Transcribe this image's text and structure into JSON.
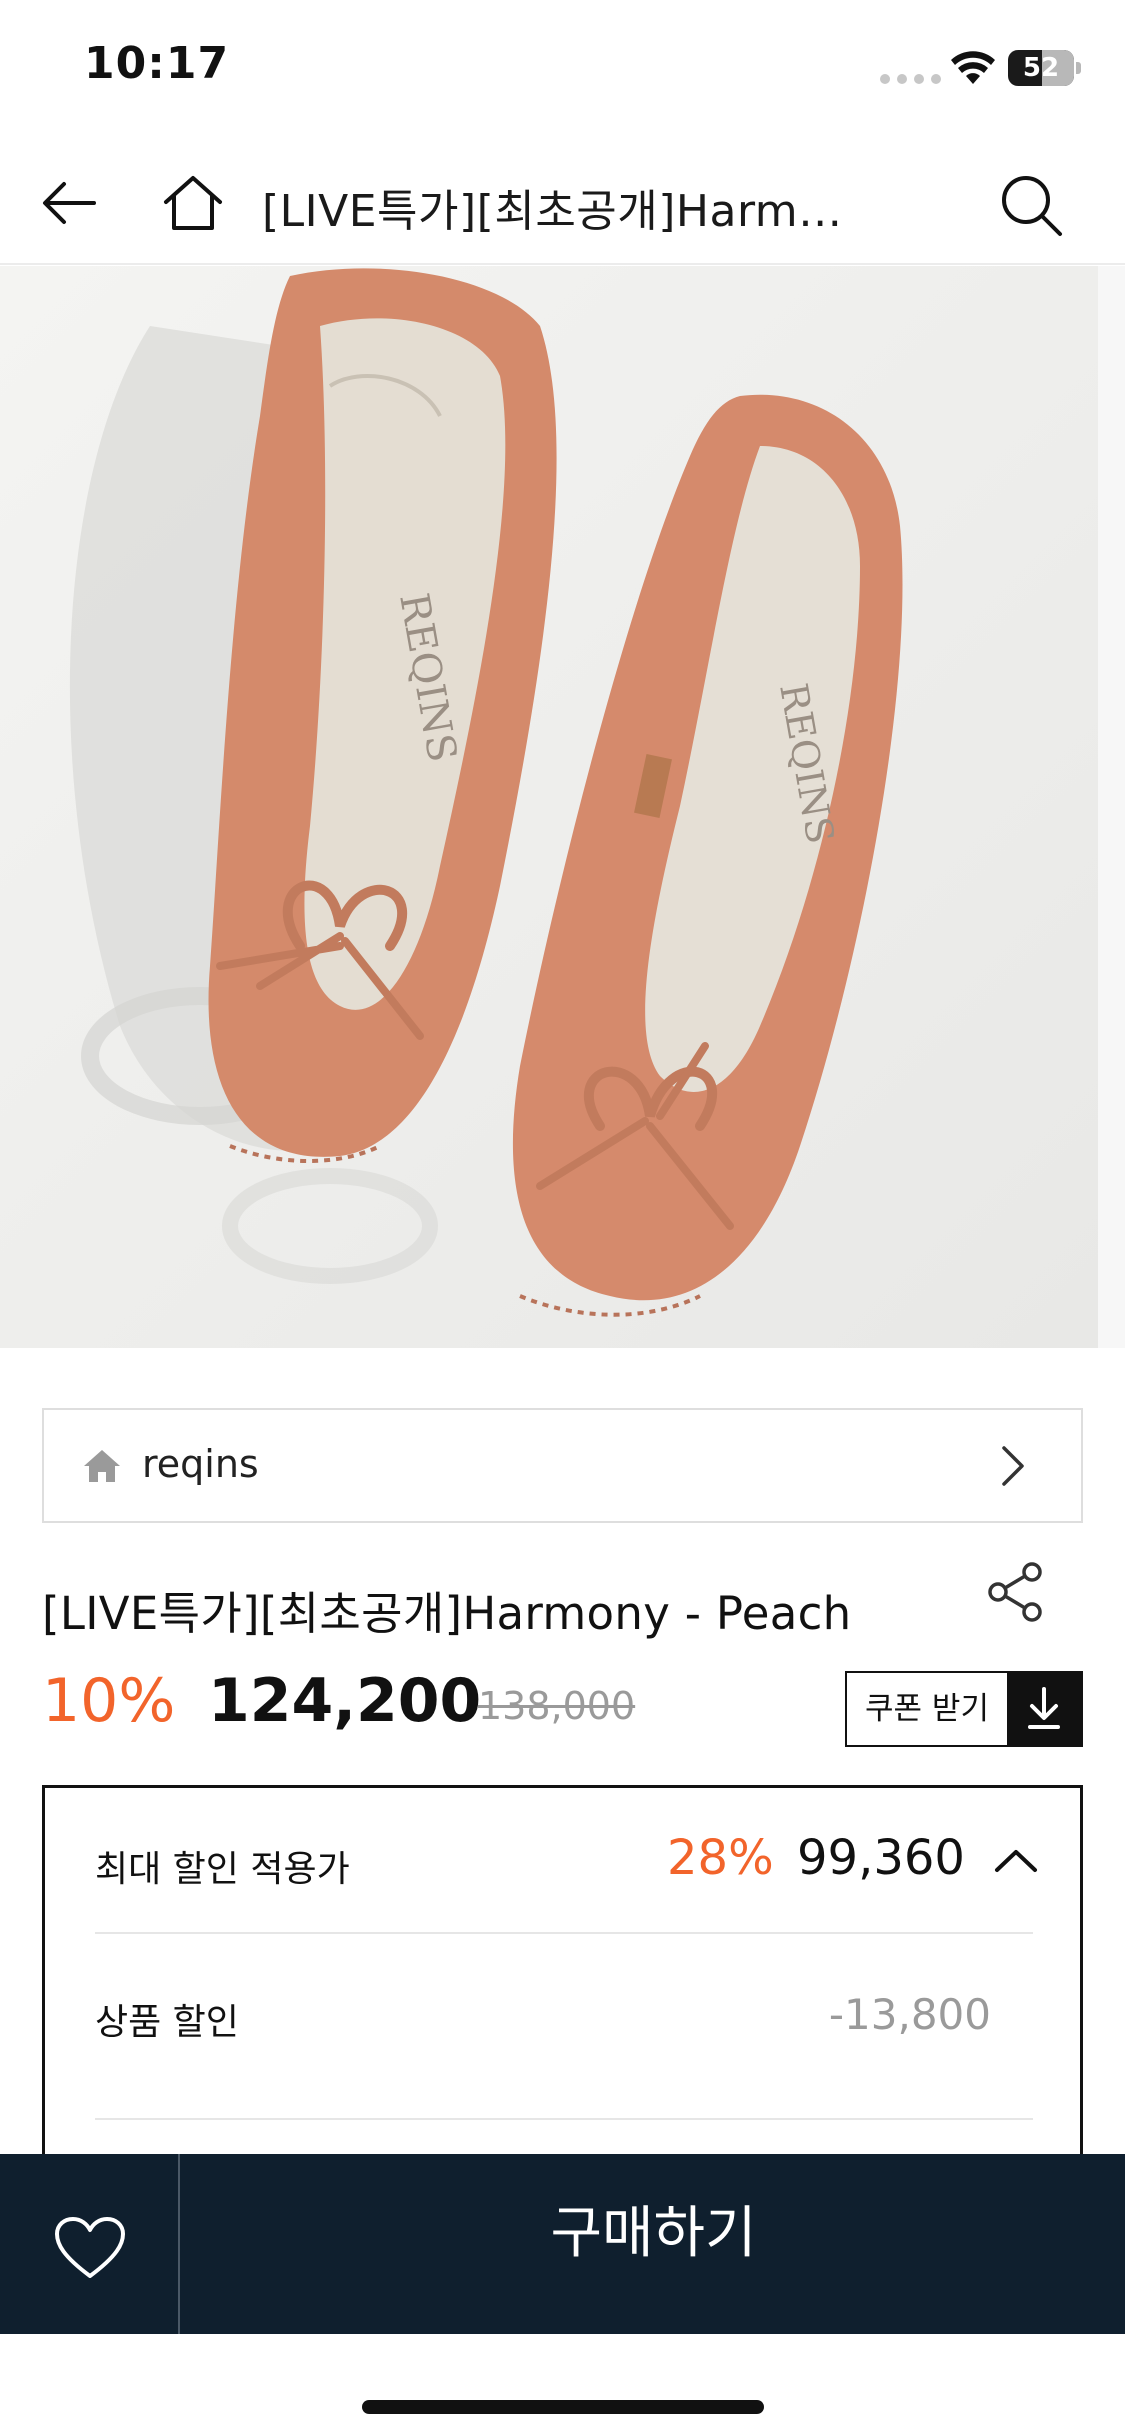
{
  "status_bar": {
    "time": "10:17",
    "battery_level": "52",
    "battery_fraction": 0.52
  },
  "nav": {
    "title": "[LIVE특가][최초공개]Harm…",
    "icons": [
      "back-arrow-icon",
      "home-icon",
      "search-icon"
    ]
  },
  "product": {
    "image_alt": "peach suede ballet flats with bow",
    "brand": "reqins",
    "title": "[LIVE특가][최초공개]Harmony - Peach",
    "discount_rate": "10%",
    "sale_price": "124,200",
    "original_price": "138,000",
    "coupon_label": "쿠폰 받기"
  },
  "discount_panel": {
    "max_label": "최대 할인 적용가",
    "max_rate": "28%",
    "max_price": "99,360",
    "product_discount_label": "상품 할인",
    "product_discount_value": "-13,800"
  },
  "bottom_bar": {
    "buy_label": "구매하기"
  },
  "colors": {
    "accent": "#f2642b",
    "bottom_bar": "#0f1f2e",
    "shoe": "#d58a6c"
  }
}
